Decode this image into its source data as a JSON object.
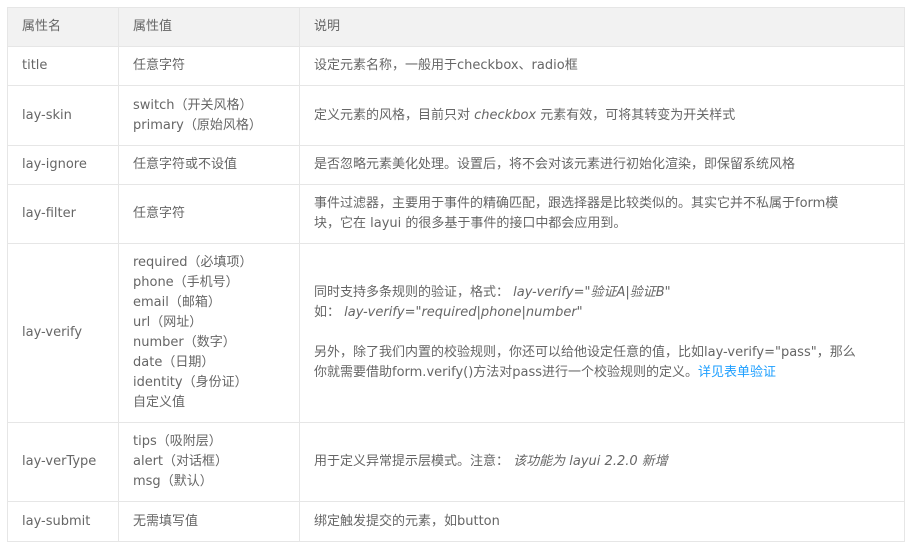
{
  "headers": [
    "属性名",
    "属性值",
    "说明"
  ],
  "rows": [
    {
      "name": "title",
      "values": [
        "任意字符"
      ],
      "desc": "设定元素名称，一般用于checkbox、radio框"
    },
    {
      "name": "lay-skin",
      "values": [
        "switch（开关风格）",
        "primary（原始风格）"
      ],
      "desc_prefix": "定义元素的风格，目前只对 ",
      "desc_em": "checkbox",
      "desc_suffix": " 元素有效，可将其转变为开关样式"
    },
    {
      "name": "lay-ignore",
      "values": [
        "任意字符或不设值"
      ],
      "desc": "是否忽略元素美化处理。设置后，将不会对该元素进行初始化渲染，即保留系统风格"
    },
    {
      "name": "lay-filter",
      "values": [
        "任意字符"
      ],
      "desc_line1": "事件过滤器，主要用于事件的精确匹配，跟选择器是比较类似的。其实它并不私属于form模",
      "desc_line2": "块，它在 layui 的很多基于事件的接口中都会应用到。"
    },
    {
      "name": "lay-verify",
      "values": [
        "required（必填项）",
        "phone（手机号）",
        "email（邮箱）",
        "url（网址）",
        "number（数字）",
        "date（日期）",
        "identity（身份证）",
        "自定义值"
      ],
      "p1_line1_prefix": "同时支持多条规则的验证，格式：",
      "p1_line1_em": "lay-verify=\"验证A|验证B\"",
      "p1_line2_prefix": "如：",
      "p1_line2_em": "lay-verify=\"required|phone|number\"",
      "p2_line1": "另外，除了我们内置的校验规则，你还可以给他设定任意的值，比如lay-verify=\"pass\"，那么",
      "p2_line2": "你就需要借助form.verify()方法对pass进行一个校验规则的定义。",
      "p2_link": "详见表单验证"
    },
    {
      "name": "lay-verType",
      "values": [
        "tips（吸附层）",
        "alert（对话框）",
        "msg（默认）"
      ],
      "desc_prefix": "用于定义异常提示层模式。注意：",
      "desc_em": "该功能为 layui 2.2.0 新增"
    },
    {
      "name": "lay-submit",
      "values": [
        "无需填写值"
      ],
      "desc": "绑定触发提交的元素，如button"
    }
  ]
}
